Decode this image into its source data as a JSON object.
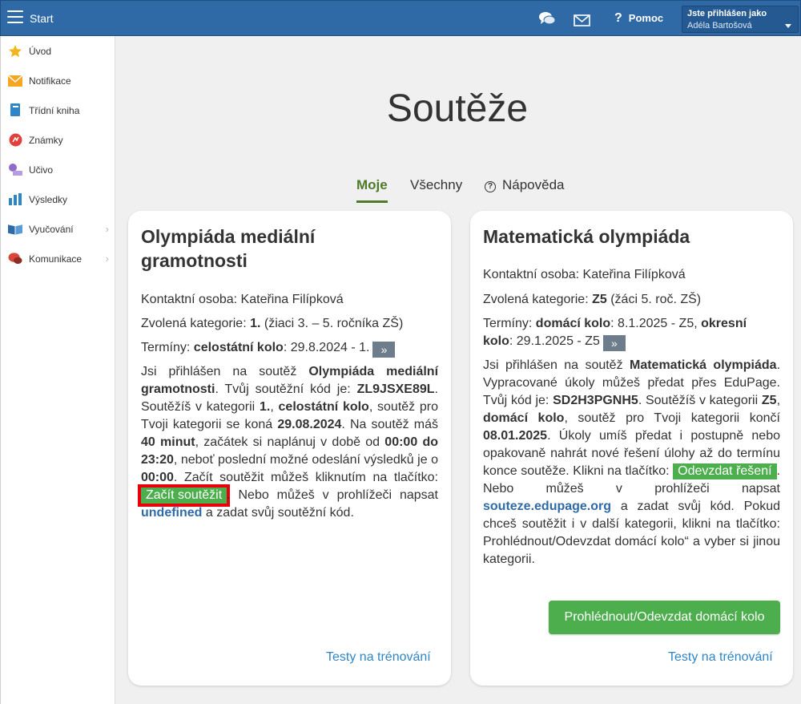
{
  "topbar": {
    "start_label": "Start",
    "help_label": "Pomoc",
    "user_line1": "Jste přihlášen jako",
    "user_line2": "Adéla Bartošová",
    "icons": [
      "menu-icon",
      "chat-icon",
      "mail-icon",
      "question-icon",
      "chevron-down-icon"
    ]
  },
  "sidebar": {
    "items": [
      {
        "label": "Úvod",
        "icon": "star-icon"
      },
      {
        "label": "Notifikace",
        "icon": "envelope-icon"
      },
      {
        "label": "Třídní kniha",
        "icon": "book-icon"
      },
      {
        "label": "Známky",
        "icon": "grades-icon"
      },
      {
        "label": "Učivo",
        "icon": "learning-icon"
      },
      {
        "label": "Výsledky",
        "icon": "bar-chart-icon"
      },
      {
        "label": "Vyučování",
        "icon": "open-book-icon"
      },
      {
        "label": "Komunikace",
        "icon": "speech-bubbles-icon"
      }
    ]
  },
  "page": {
    "title": "Soutěže",
    "tabs": [
      {
        "label": "Moje",
        "active": true
      },
      {
        "label": "Všechny",
        "active": false
      },
      {
        "label": "Nápověda",
        "active": false
      }
    ]
  },
  "card1": {
    "title_line1": "Olympiáda mediální",
    "title_line2": "gramotnosti",
    "contact_label": "Kontaktní osoba:",
    "contact_value": "Kateřina Filípková",
    "category_label": "Zvolená kategorie:",
    "category_value": "1.",
    "category_desc": "(žiaci 3. – 5. ročníka ZŠ)",
    "terms_label": "Termíny:",
    "terms_round": "celostátní kolo",
    "terms_date": ": 29.8.2024 - 1.",
    "more_label": "»",
    "p1": "Jsi přihlášen na soutěž",
    "p_name": "Olympiáda mediální gramotnosti",
    "p2": ". Tvůj soutěžní kód je:",
    "p_code": "ZL9JSXE89L",
    "p3": ". Soutěžíš v kategorii",
    "p_cat": "1.",
    "p4": ",",
    "p_round": "celostátní kolo",
    "p5": ", soutěž pro Tvoji kategorii se koná",
    "p_date": "29.08.2024",
    "p6": ". Na soutěž máš",
    "p_minutes": "40 minut",
    "p7": ", začátek si naplánuj v době od",
    "p_time": "00:00 do 23:20",
    "p8": ", neboť poslední možné odeslání výsledků je o",
    "p_last": "00:00",
    "p9": ". Začít soutěžit můžeš kliknutím na tlačítko:",
    "start_button": "Začít soutěžit",
    "p10": ". Nebo můžeš v prohlížeči napsat",
    "p_link": "undefined",
    "p11": "a zadat svůj soutěžní kód.",
    "training_link": "Testy na trénování"
  },
  "card2": {
    "title": "Matematická olympiáda",
    "contact_label": "Kontaktní osoba:",
    "contact_value": "Kateřina Filípková",
    "category_label": "Zvolená kategorie:",
    "category_value": "Z5",
    "category_desc": "(žáci 5. roč. ZŠ)",
    "terms_label": "Termíny:",
    "terms_round1": "domácí kolo",
    "terms_date1": ": 8.1.2025 - Z5,",
    "terms_round2_a": "okresní",
    "terms_round2_b": "kolo",
    "terms_date2": ": 29.1.2025 - Z5",
    "more_label": "»",
    "p1": "Jsi přihlášen na soutěž",
    "p_name": "Matematická olympiáda",
    "p2": ". Vypracované úkoly můžeš předat přes EduPage. Tvůj kód je:",
    "p_code": "SD2H3PGNH5",
    "p3": ". Soutěžíš v kategorii",
    "p_cat": "Z5",
    "p4": ",",
    "p_round": "domácí kolo",
    "p5": ", soutěž pro Tvoji kategorii končí",
    "p_date": "08.01.2025",
    "p6": ". Úkoly umíš předat i postupně nebo opakovaně nahrát nové řešení úlohy až do termínu konce soutěže. Klikni na tlačítko:",
    "submit_button": "Odevzdat řešení",
    "p7": ". Nebo můžeš v prohlížeči napsat",
    "p_link": "souteze.edupage.org",
    "p8": "a zadat svůj kód. Pokud chceš soutěžit i v další kategorii, klikni na tlačítko: Prohlédnout/Odevzdat domácí kolo“ a vyber si jinou kategorii.",
    "big_button": "Prohlédnout/Odevzdat domácí kolo",
    "training_link": "Testy na trénování"
  }
}
